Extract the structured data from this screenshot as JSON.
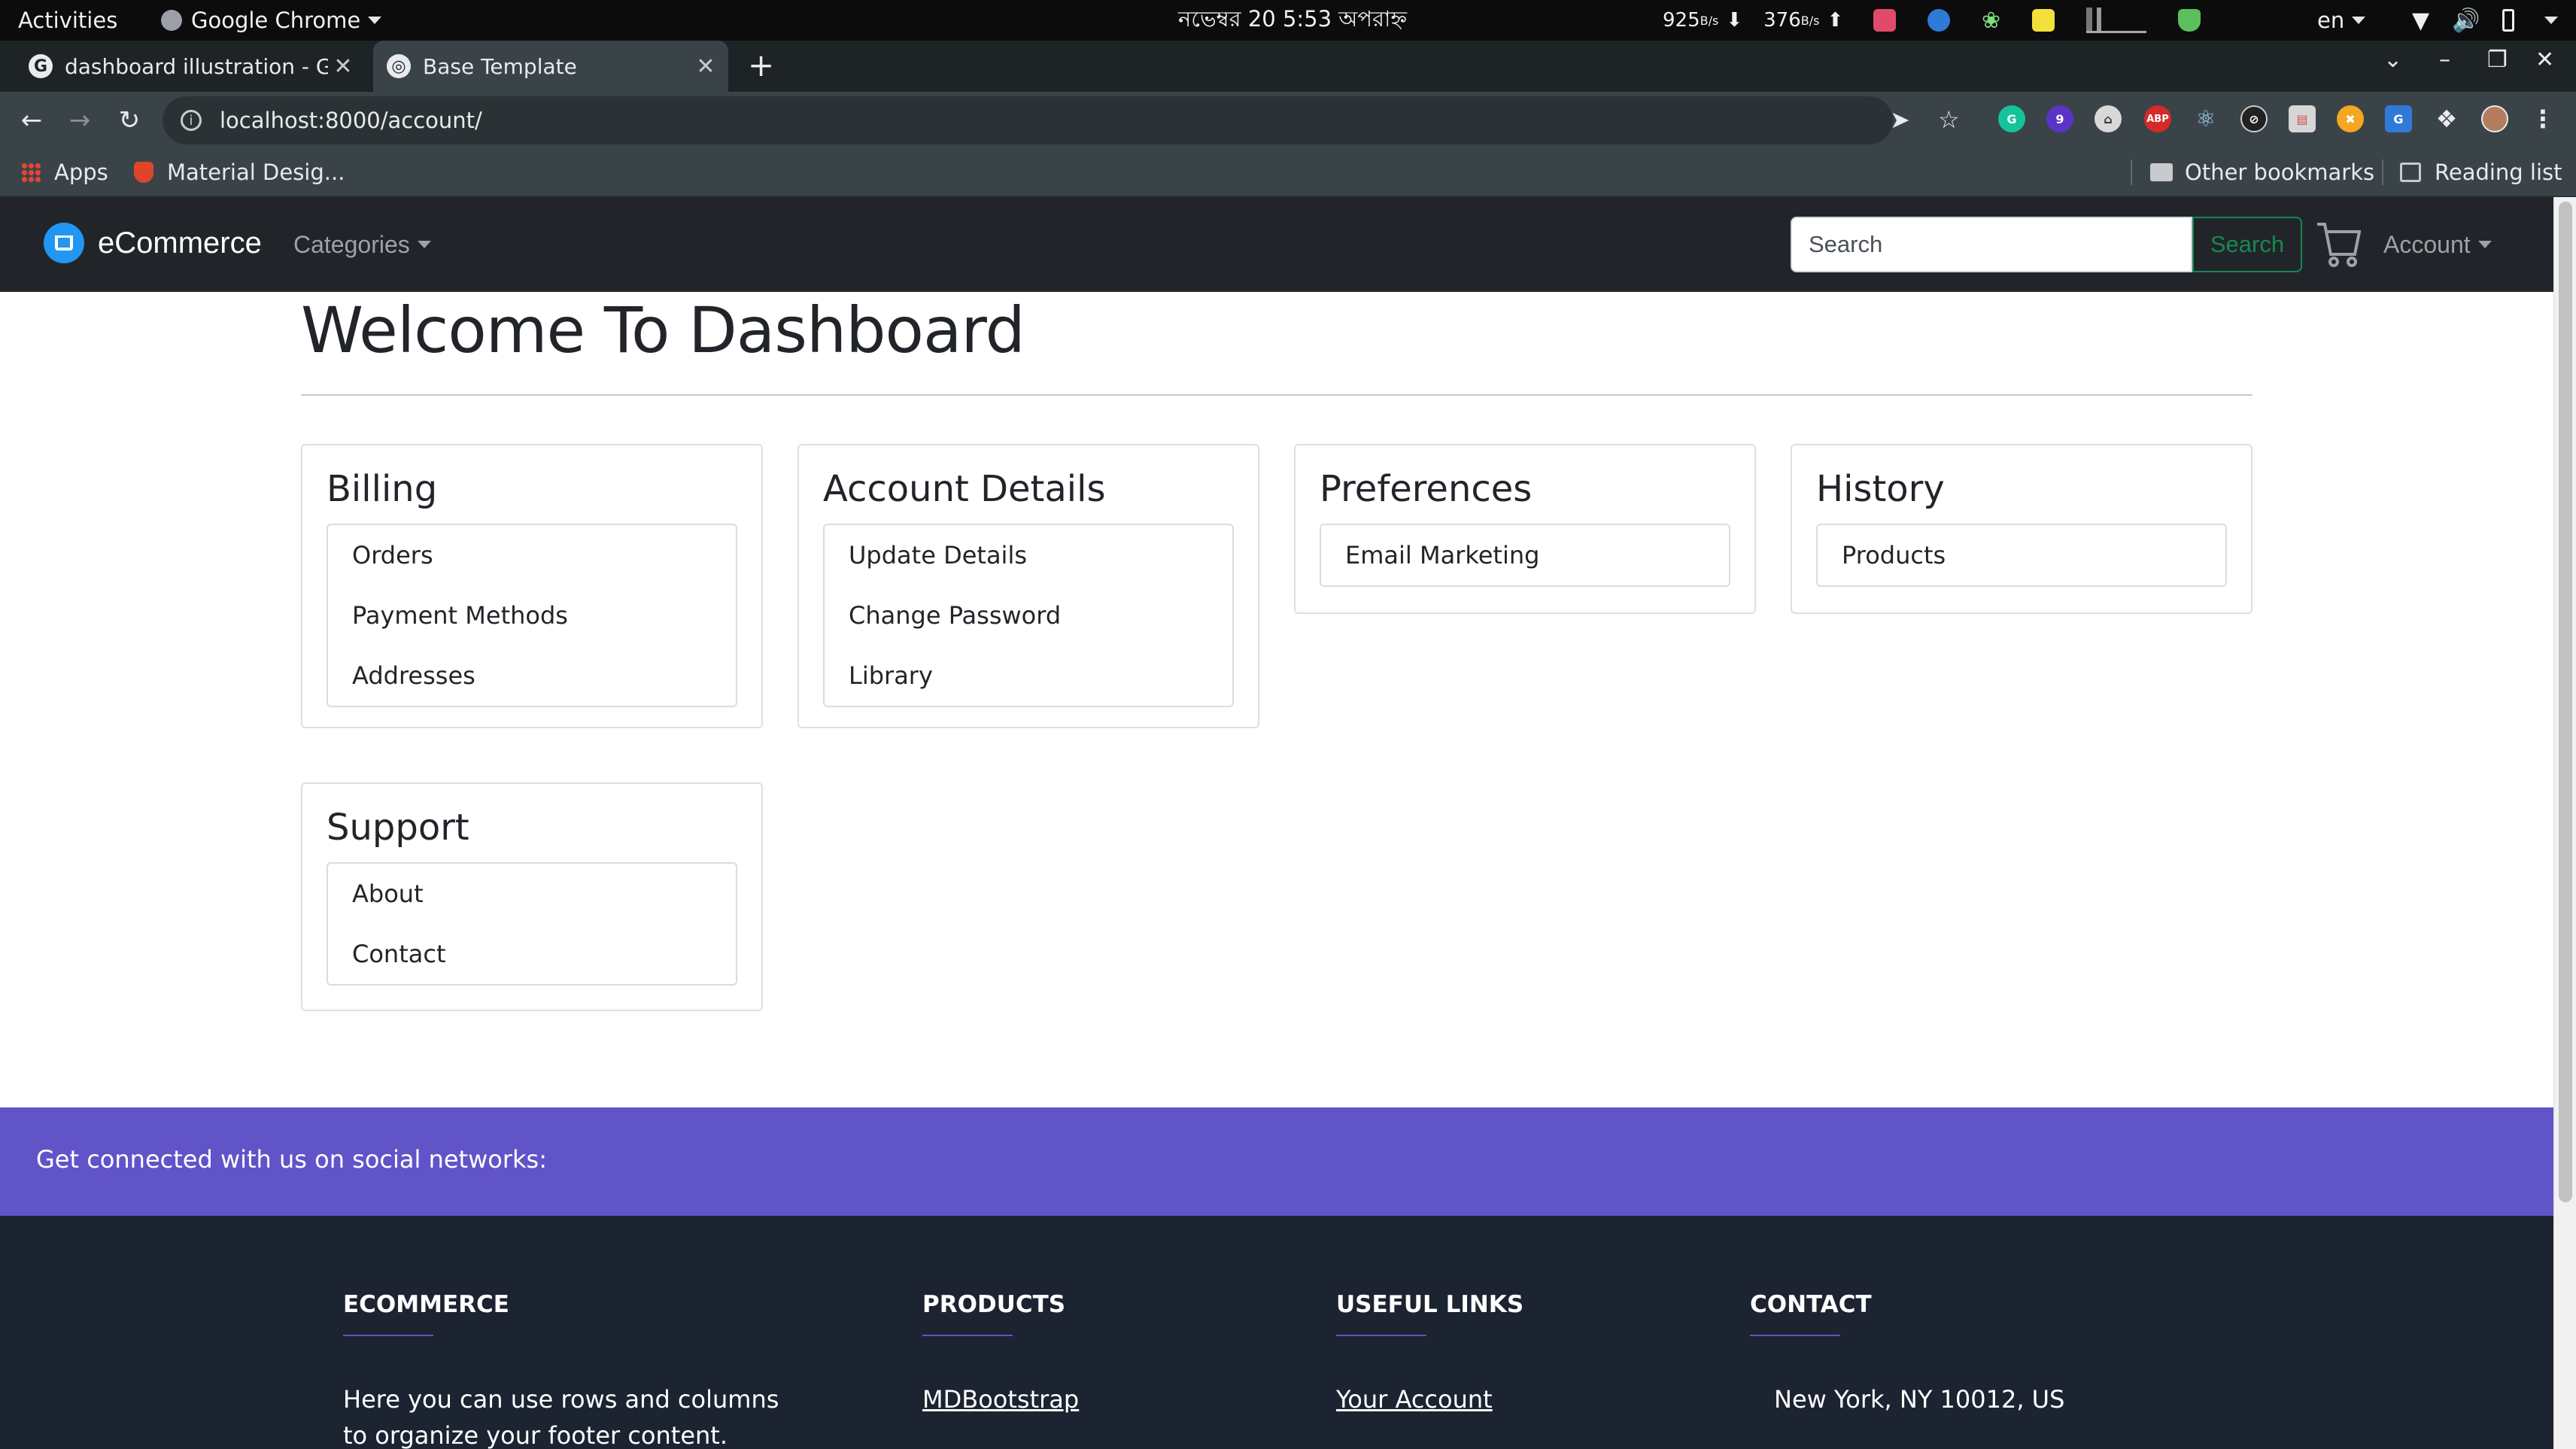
{
  "os_bar": {
    "activities": "Activities",
    "app_name": "Google Chrome",
    "clock": "নভেম্বর 20   5:53 অপরাহ্ন",
    "net_down": "925",
    "net_down_unit": "B/s",
    "net_up": "376",
    "net_up_unit": "B/s",
    "language": "en"
  },
  "browser": {
    "tabs": [
      {
        "title": "dashboard illustration - Google",
        "active": false
      },
      {
        "title": "Base Template",
        "active": true
      }
    ],
    "url": "localhost:8000/account/",
    "bookmarks": {
      "apps": "Apps",
      "material": "Material Desig...",
      "other": "Other bookmarks",
      "reading": "Reading list"
    }
  },
  "site": {
    "brand": "eCommerce",
    "categories": "Categories",
    "search_placeholder": "Search",
    "search_button": "Search",
    "account": "Account"
  },
  "dashboard": {
    "title": "Welcome To Dashboard",
    "cards": {
      "billing": {
        "title": "Billing",
        "items": [
          "Orders",
          "Payment Methods",
          "Addresses"
        ]
      },
      "account": {
        "title": "Account Details",
        "items": [
          "Update Details",
          "Change Password",
          "Library"
        ]
      },
      "preferences": {
        "title": "Preferences",
        "items": [
          "Email Marketing"
        ]
      },
      "history": {
        "title": "History",
        "items": [
          "Products"
        ]
      },
      "support": {
        "title": "Support",
        "items": [
          "About",
          "Contact"
        ]
      }
    }
  },
  "footer": {
    "social_text": "Get connected with us on social networks:",
    "columns": {
      "ecommerce": {
        "heading": "ECOMMERCE",
        "text": "Here you can use rows and columns to organize your footer content. Lorem"
      },
      "products": {
        "heading": "PRODUCTS",
        "link": "MDBootstrap"
      },
      "useful": {
        "heading": "USEFUL LINKS",
        "link": "Your Account"
      },
      "contact": {
        "heading": "CONTACT",
        "text": "New York, NY 10012, US"
      }
    }
  },
  "colors": {
    "navbar": "#212529",
    "brand_blue": "#2196f3",
    "search_green": "#198754",
    "social_bar": "#6154c9",
    "footer": "#1c2331"
  }
}
